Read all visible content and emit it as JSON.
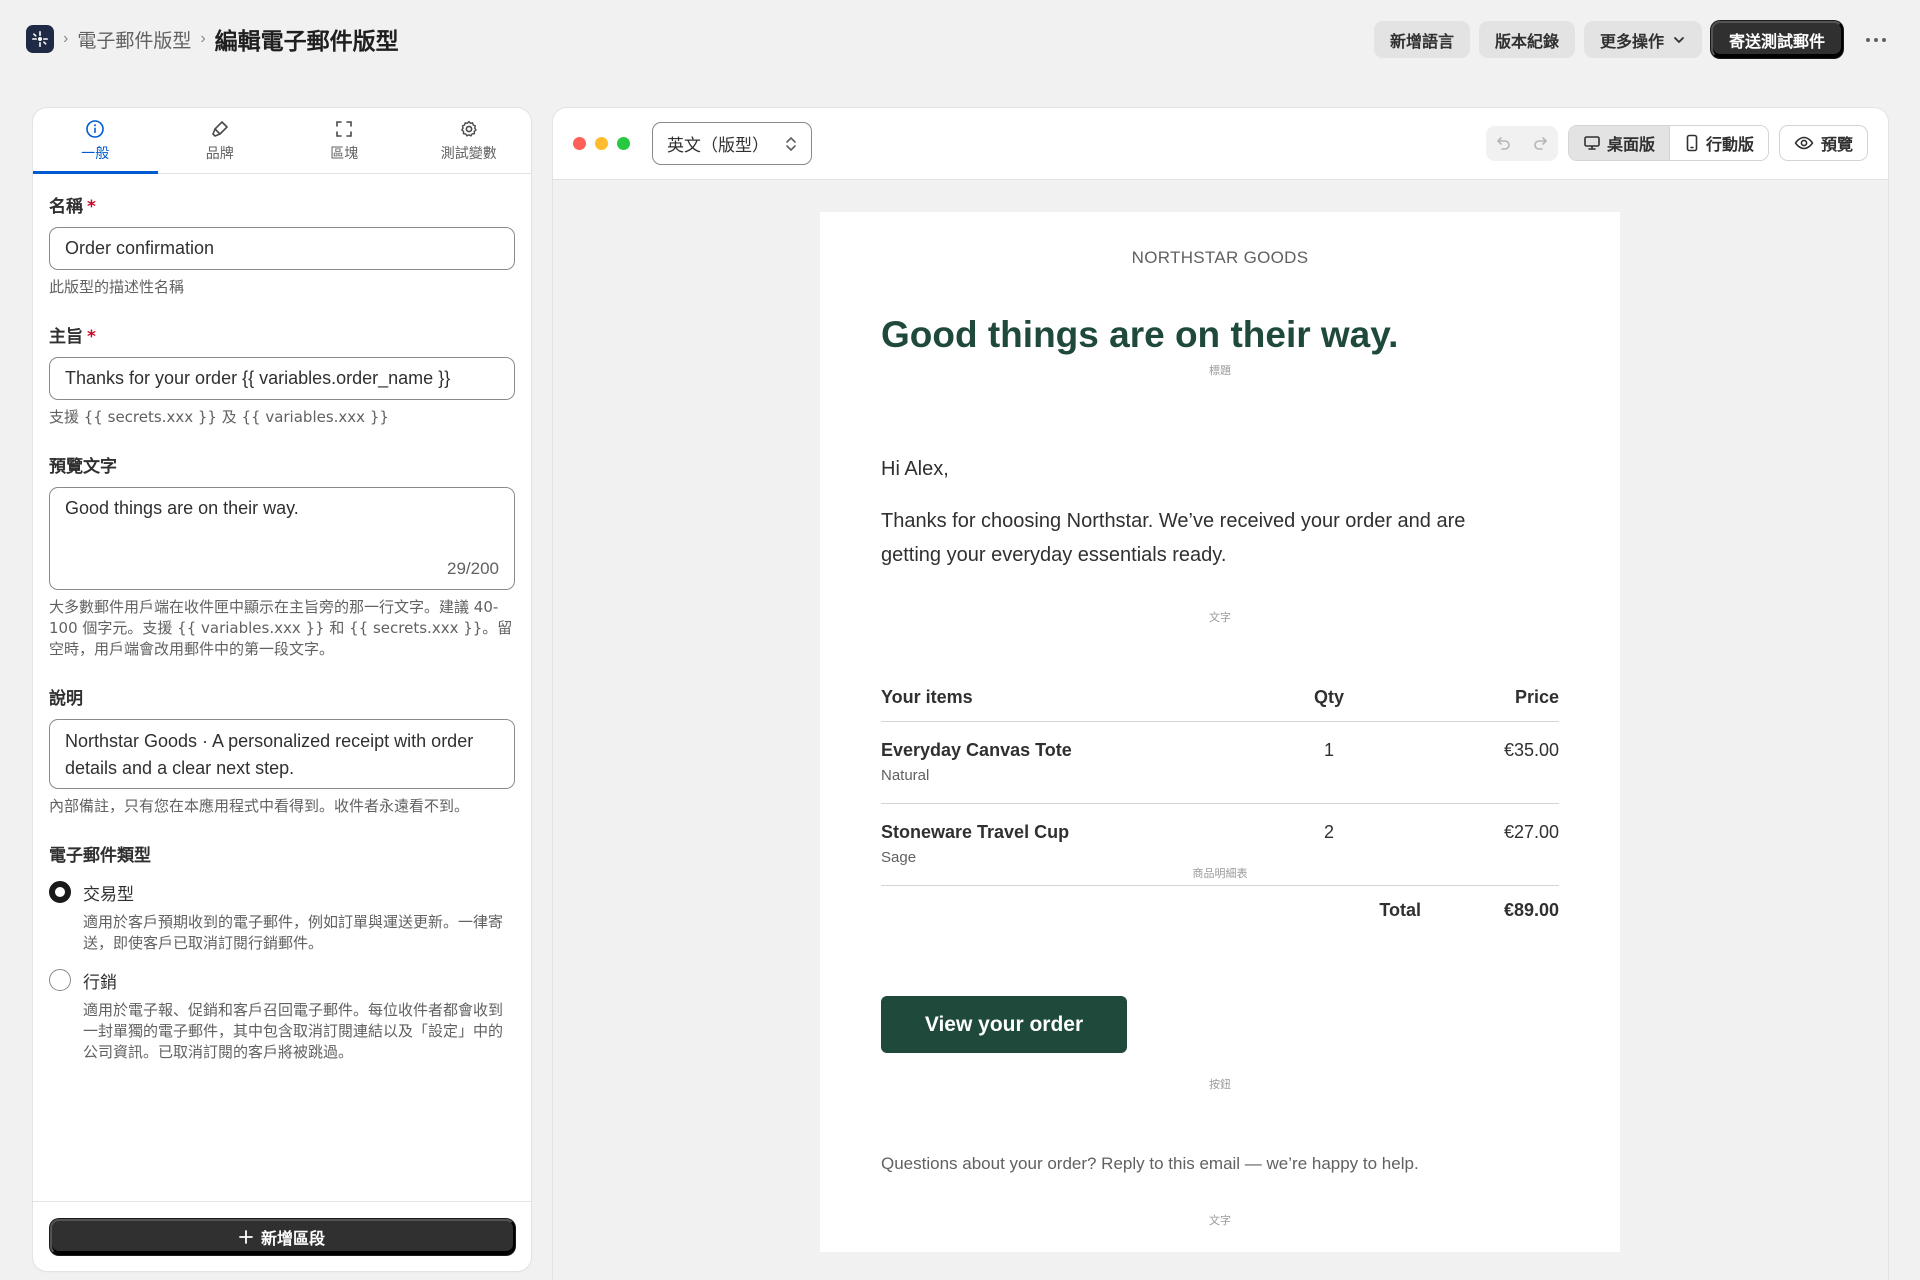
{
  "header": {
    "breadcrumb_parent": "電子郵件版型",
    "title": "編輯電子郵件版型",
    "actions": {
      "add_language": "新增語言",
      "version_history": "版本紀錄",
      "more_actions": "更多操作",
      "send_test": "寄送測試郵件"
    }
  },
  "tabs": [
    {
      "label": "一般",
      "icon": "info-icon",
      "active": true
    },
    {
      "label": "品牌",
      "icon": "brush-icon"
    },
    {
      "label": "區塊",
      "icon": "frame-icon"
    },
    {
      "label": "測試變數",
      "icon": "gear-icon"
    }
  ],
  "form": {
    "name": {
      "label": "名稱",
      "required_mark": "*",
      "value": "Order confirmation",
      "help": "此版型的描述性名稱"
    },
    "subject": {
      "label": "主旨",
      "required_mark": "*",
      "value": "Thanks for your order {{ variables.order_name }}",
      "help": "支援 {{ secrets.xxx }} 及 {{ variables.xxx }}"
    },
    "preview_text": {
      "label": "預覽文字",
      "value": "Good things are on their way.",
      "counter": "29/200",
      "help": "大多數郵件用戶端在收件匣中顯示在主旨旁的那一行文字。建議 40-100 個字元。支援 {{ variables.xxx }} 和 {{ secrets.xxx }}。留空時，用戶端會改用郵件中的第一段文字。"
    },
    "description": {
      "label": "說明",
      "value": "Northstar Goods · A personalized receipt with order details and a clear next step.",
      "help": "內部備註，只有您在本應用程式中看得到。收件者永遠看不到。"
    },
    "email_type": {
      "label": "電子郵件類型",
      "options": [
        {
          "label": "交易型",
          "desc": "適用於客戶預期收到的電子郵件，例如訂單與運送更新。一律寄送，即使客戶已取消訂閱行銷郵件。",
          "checked": true
        },
        {
          "label": "行銷",
          "desc": "適用於電子報、促銷和客戶召回電子郵件。每位收件者都會收到一封單獨的電子郵件，其中包含取消訂閱連結以及「設定」中的公司資訊。已取消訂閱的客戶將被跳過。",
          "checked": false
        }
      ]
    },
    "add_section": "新增區段"
  },
  "preview": {
    "language": "英文（版型）",
    "desktop_label": "桌面版",
    "mobile_label": "行動版",
    "preview_label": "預覽",
    "view_mode": "desktop"
  },
  "email": {
    "brand": "NORTHSTAR GOODS",
    "heading": "Good things are on their way.",
    "heading_tag": "標題",
    "greeting": "Hi Alex,",
    "body": "Thanks for choosing Northstar. We’ve received your order and are getting your everyday essentials ready.",
    "body_tag": "文字",
    "items_table": {
      "col_items": "Your items",
      "col_qty": "Qty",
      "col_price": "Price",
      "rows": [
        {
          "name": "Everyday Canvas Tote",
          "variant": "Natural",
          "qty": "1",
          "price": "€35.00"
        },
        {
          "name": "Stoneware Travel Cup",
          "variant": "Sage",
          "qty": "2",
          "price": "€27.00"
        }
      ],
      "total_label": "Total",
      "total_value": "€89.00",
      "tag": "商品明細表"
    },
    "cta": "View your order",
    "cta_tag": "按鈕",
    "footer": "Questions about your order? Reply to this email — we’re happy to help.",
    "footer_tag": "文字"
  },
  "colors": {
    "accent_blue": "#005bd3",
    "brand_green": "#1f4a3b",
    "dark_button": "#303030"
  }
}
